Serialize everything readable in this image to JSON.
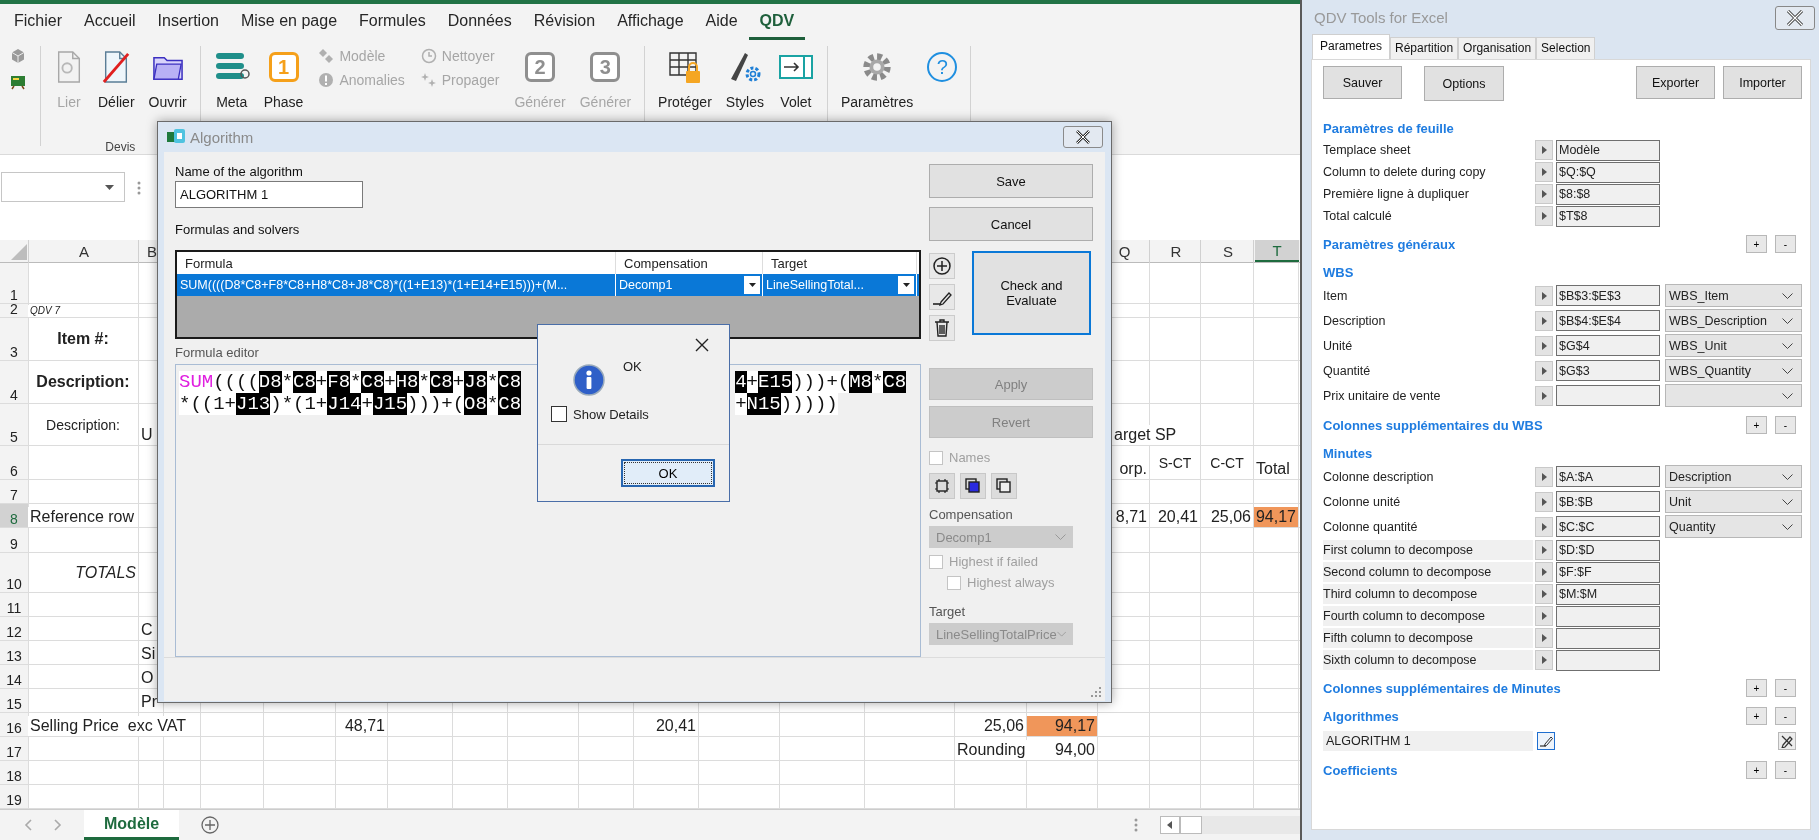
{
  "ribbon": {
    "tabs": [
      {
        "label": "Fichier",
        "selected": false
      },
      {
        "label": "Accueil",
        "selected": false
      },
      {
        "label": "Insertion",
        "selected": false
      },
      {
        "label": "Mise en page",
        "selected": false
      },
      {
        "label": "Formules",
        "selected": false
      },
      {
        "label": "Données",
        "selected": false
      },
      {
        "label": "Révision",
        "selected": false
      },
      {
        "label": "Affichage",
        "selected": false
      },
      {
        "label": "Aide",
        "selected": false
      },
      {
        "label": "QDV",
        "selected": true
      }
    ],
    "groups": [
      {
        "label": "Devis",
        "items": [
          {
            "kind": "large",
            "label": "Lier",
            "disabled": true
          },
          {
            "kind": "large",
            "label": "Délier",
            "disabled": false
          },
          {
            "kind": "large",
            "label": "Ouvrir",
            "disabled": false
          }
        ]
      },
      {
        "items": [
          {
            "kind": "large",
            "label": "Meta",
            "disabled": false
          },
          {
            "kind": "badge",
            "label": "Phase",
            "badge": "1",
            "disabled": false
          },
          {
            "kind": "stack",
            "items": [
              {
                "label": "Modèle",
                "disabled": true
              },
              {
                "label": "Anomalies",
                "disabled": true
              }
            ]
          },
          {
            "kind": "stack",
            "items": [
              {
                "label": "Nettoyer",
                "disabled": true
              },
              {
                "label": "Propager",
                "disabled": true
              }
            ]
          },
          {
            "kind": "badge",
            "label": "Générer",
            "badge": "2",
            "disabled": true
          },
          {
            "kind": "badge",
            "label": "Générer",
            "badge": "3",
            "disabled": true
          }
        ]
      },
      {
        "items": [
          {
            "kind": "large",
            "label": "Protéger",
            "disabled": false
          },
          {
            "kind": "large",
            "label": "Styles",
            "disabled": false
          },
          {
            "kind": "large",
            "label": "Volet",
            "disabled": false
          }
        ]
      },
      {
        "items": [
          {
            "kind": "large",
            "label": "Paramètres",
            "disabled": false
          },
          {
            "kind": "glyph",
            "glyph": "?",
            "disabled": false
          }
        ]
      }
    ]
  },
  "sheet": {
    "columns": {
      "A": {
        "label": "A",
        "selected": false
      },
      "B": {
        "label": "B",
        "selected": false
      },
      "Q": {
        "label": "Q",
        "selected": false
      },
      "R": {
        "label": "R",
        "selected": false
      },
      "S": {
        "label": "S",
        "selected": false
      },
      "T": {
        "label": "T",
        "selected": true
      }
    },
    "rows": [
      {
        "number": "1",
        "selected": false,
        "cells": {}
      },
      {
        "number": "2",
        "selected": false,
        "cells": {
          "A": {
            "text": "QDV 7",
            "kind": "note"
          }
        }
      },
      {
        "number": "3",
        "selected": false,
        "cells": {
          "A": {
            "text": "Item #:",
            "kind": "bold"
          }
        }
      },
      {
        "number": "4",
        "selected": false,
        "cells": {
          "A": {
            "text": "Description:",
            "kind": "bold"
          }
        }
      },
      {
        "number": "5",
        "selected": false,
        "cells": {
          "A": {
            "text": "Description:",
            "kind": "centered"
          },
          "B": {
            "text": "U"
          },
          "Q": {
            "text": "arget SP",
            "kind": "text"
          }
        }
      },
      {
        "number": "6",
        "selected": false,
        "cells": {
          "Q": {
            "text": "orp.",
            "kind": "number"
          },
          "R": {
            "text": "S-CT",
            "kind": "centered"
          },
          "S": {
            "text": "C-CT",
            "kind": "centered"
          },
          "T": {
            "text": "Total",
            "kind": "text"
          }
        }
      },
      {
        "number": "7",
        "selected": false,
        "cells": {}
      },
      {
        "number": "8",
        "selected": true,
        "cells": {
          "A": {
            "text": "Reference row",
            "kind": "text"
          },
          "Q": {
            "text": "8,71",
            "kind": "number"
          },
          "R": {
            "text": "20,41",
            "kind": "number"
          },
          "S": {
            "text": "25,06",
            "kind": "number"
          },
          "T": {
            "text": "94,17",
            "kind": "number",
            "highlighted": true
          }
        }
      },
      {
        "number": "9",
        "selected": false,
        "cells": {}
      },
      {
        "number": "10",
        "selected": false,
        "cells": {
          "A": {
            "text": "TOTALS",
            "kind": "italic"
          }
        }
      },
      {
        "number": "11",
        "selected": false,
        "cells": {}
      },
      {
        "number": "12",
        "selected": false,
        "cells": {
          "B": {
            "text": "C"
          }
        }
      },
      {
        "number": "13",
        "selected": false,
        "cells": {
          "B": {
            "text": "Si"
          }
        }
      },
      {
        "number": "14",
        "selected": false,
        "cells": {
          "B": {
            "text": "O"
          }
        }
      },
      {
        "number": "15",
        "selected": false,
        "cells": {
          "B": {
            "text": "Pr"
          }
        }
      },
      {
        "number": "16",
        "selected": false,
        "cells": {
          "A": {
            "text": "Selling Price  exc VAT",
            "kind": "text"
          },
          "F": {
            "text": "48,71",
            "kind": "number"
          },
          "K": {
            "text": "20,41",
            "kind": "number"
          },
          "O": {
            "text": "25,06",
            "kind": "number"
          },
          "P": {
            "text": "94,17",
            "kind": "number",
            "highlighted": true
          }
        }
      },
      {
        "number": "17",
        "selected": false,
        "cells": {
          "O": {
            "text": "Rounding",
            "kind": "text"
          },
          "P": {
            "text": "94,00",
            "kind": "number"
          }
        }
      },
      {
        "number": "18",
        "selected": false,
        "cells": {}
      },
      {
        "number": "19",
        "selected": false,
        "cells": {}
      }
    ],
    "tabs": [
      {
        "label": "Modèle",
        "selected": true
      }
    ]
  },
  "dialog": {
    "title": "Algorithm",
    "name_label": "Name of the algorithm",
    "name_value": "ALGORITHM 1",
    "formulas_label": "Formulas and solvers",
    "grid": {
      "columns": [
        "Formula",
        "Compensation",
        "Target"
      ],
      "rows": [
        {
          "selected": true,
          "formula": "SUM((((D8*C8+F8*C8+H8*C8+J8*C8)*((1+E13)*(1+E14+E15)))+(M...",
          "compensation": "Decomp1",
          "target": "LineSellingTotal..."
        }
      ]
    },
    "editor_label": "Formula editor",
    "editor_lines": [
      {
        "left": [
          {
            "kind": "func",
            "text": "SUM"
          },
          {
            "kind": "op",
            "text": "(((("
          },
          {
            "kind": "ref",
            "text": "D8"
          },
          {
            "kind": "op",
            "text": "*"
          },
          {
            "kind": "ref",
            "text": "C8"
          },
          {
            "kind": "op",
            "text": "+"
          },
          {
            "kind": "ref",
            "text": "F8"
          },
          {
            "kind": "op",
            "text": "*"
          },
          {
            "kind": "ref",
            "text": "C8"
          },
          {
            "kind": "op",
            "text": "+"
          },
          {
            "kind": "ref",
            "text": "H8"
          },
          {
            "kind": "op",
            "text": "*"
          },
          {
            "kind": "ref",
            "text": "C8"
          },
          {
            "kind": "op",
            "text": "+"
          },
          {
            "kind": "ref",
            "text": "J8"
          },
          {
            "kind": "op",
            "text": "*"
          },
          {
            "kind": "ref",
            "text": "C8"
          }
        ],
        "right": [
          {
            "kind": "ref",
            "text": "4"
          },
          {
            "kind": "op",
            "text": "+"
          },
          {
            "kind": "ref",
            "text": "E15"
          },
          {
            "kind": "op",
            "text": ")))+("
          },
          {
            "kind": "ref",
            "text": "M8"
          },
          {
            "kind": "op",
            "text": "*"
          },
          {
            "kind": "ref",
            "text": "C8"
          }
        ]
      },
      {
        "left": [
          {
            "kind": "op",
            "text": "*((1+"
          },
          {
            "kind": "ref",
            "text": "J13"
          },
          {
            "kind": "op",
            "text": ")*(1+"
          },
          {
            "kind": "ref",
            "text": "J14"
          },
          {
            "kind": "op",
            "text": "+"
          },
          {
            "kind": "ref",
            "text": "J15"
          },
          {
            "kind": "op",
            "text": ")))+("
          },
          {
            "kind": "ref",
            "text": "O8"
          },
          {
            "kind": "op",
            "text": "*"
          },
          {
            "kind": "ref",
            "text": "C8"
          }
        ],
        "right": [
          {
            "kind": "op",
            "text": "+"
          },
          {
            "kind": "ref",
            "text": "N15"
          },
          {
            "kind": "op",
            "text": ")))))"
          }
        ]
      }
    ],
    "save": {
      "label": "Save",
      "disabled": false
    },
    "cancel": {
      "label": "Cancel",
      "disabled": false
    },
    "check": {
      "label": "Check and Evaluate",
      "disabled": false
    },
    "apply": {
      "label": "Apply",
      "disabled": true
    },
    "revert": {
      "label": "Revert",
      "disabled": true
    },
    "names": {
      "label": "Names",
      "checked": false,
      "disabled": true
    },
    "compensation": {
      "label": "Compensation",
      "value": "Decomp1",
      "disabled": true
    },
    "highest_if_failed": {
      "label": "Highest if failed",
      "checked": false,
      "disabled": true
    },
    "highest_always": {
      "label": "Highest always",
      "checked": false,
      "disabled": true
    },
    "target": {
      "label": "Target",
      "value": "LineSellingTotalPrice",
      "disabled": true
    }
  },
  "message_box": {
    "text": "OK",
    "show_details": {
      "label": "Show Details",
      "checked": false
    },
    "button": "OK"
  },
  "qdv": {
    "title": "QDV Tools for Excel",
    "tabs": [
      {
        "label": "Parametres",
        "selected": true
      },
      {
        "label": "Répartition",
        "selected": false
      },
      {
        "label": "Organisation",
        "selected": false
      },
      {
        "label": "Selection",
        "selected": false
      }
    ],
    "buttons": [
      "Sauver",
      "Options",
      "Exporter",
      "Importer"
    ],
    "sections": [
      {
        "title": "Paramètres de feuille",
        "rows": [
          {
            "kind": "field",
            "label": "Templace sheet",
            "value": "Modèle"
          },
          {
            "kind": "field",
            "label": "Column to delete during copy",
            "value": "$Q:$Q"
          },
          {
            "kind": "field",
            "label": "Première ligne à dupliquer",
            "value": "$8:$8"
          },
          {
            "kind": "field",
            "label": "Total calculé",
            "value": "$T$8"
          }
        ]
      },
      {
        "title": "Paramètres généraux",
        "add": "+",
        "remove": "-"
      },
      {
        "title": "WBS",
        "rows": [
          {
            "kind": "field-select",
            "label": "Item",
            "value": "$B$3:$E$3",
            "select": "WBS_Item"
          },
          {
            "kind": "field-select",
            "label": "Description",
            "value": "$B$4:$E$4",
            "select": "WBS_Description"
          },
          {
            "kind": "field-select",
            "label": "Unité",
            "value": "$G$4",
            "select": "WBS_Unit"
          },
          {
            "kind": "field-select",
            "label": "Quantité",
            "value": "$G$3",
            "select": "WBS_Quantity"
          },
          {
            "kind": "field-select",
            "label": "Prix unitaire de vente"
          }
        ]
      },
      {
        "title": "Colonnes supplémentaires du WBS",
        "add": "+",
        "remove": "-"
      },
      {
        "title": "Minutes",
        "rows": [
          {
            "kind": "field-select",
            "label": "Colonne description",
            "value": "$A:$A",
            "select": "Description"
          },
          {
            "kind": "field-select",
            "label": "Colonne unité",
            "value": "$B:$B",
            "select": "Unit"
          },
          {
            "kind": "field-select",
            "label": "Colonne quantité",
            "value": "$C:$C",
            "select": "Quantity"
          },
          {
            "kind": "field-shaded",
            "label": "First column to decompose",
            "value": "$D:$D"
          },
          {
            "kind": "field-shaded",
            "label": "Second column to decompose",
            "value": "$F:$F"
          },
          {
            "kind": "field-shaded",
            "label": "Third column to decompose",
            "value": "$M:$M"
          },
          {
            "kind": "field-shaded",
            "label": "Fourth column to decompose"
          },
          {
            "kind": "field-shaded",
            "label": "Fifth column to decompose"
          },
          {
            "kind": "field-shaded",
            "label": "Sixth column to decompose"
          }
        ]
      },
      {
        "title": "Colonnes supplémentaires de Minutes",
        "add": "+",
        "remove": "-"
      },
      {
        "title": "Algorithmes",
        "add": "+",
        "remove": "-",
        "rows": [
          {
            "kind": "algorithm",
            "label": "ALGORITHM 1"
          }
        ]
      },
      {
        "title": "Coefficients",
        "add": "+",
        "remove": "-"
      }
    ]
  }
}
